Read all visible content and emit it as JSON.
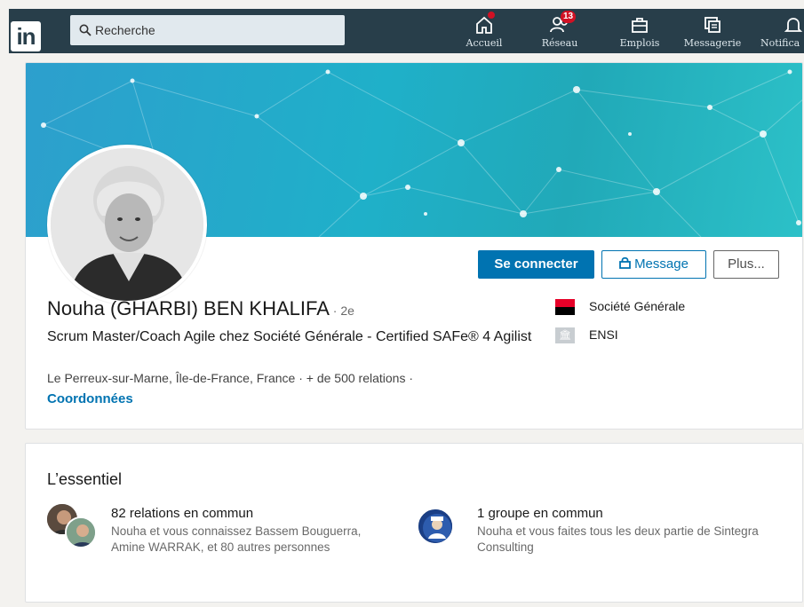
{
  "nav": {
    "logo": "in",
    "search_placeholder": "Recherche",
    "items": [
      {
        "label": "Accueil",
        "icon": "home-icon",
        "badge": "dot"
      },
      {
        "label": "Réseau",
        "icon": "network-icon",
        "badge": "13"
      },
      {
        "label": "Emplois",
        "icon": "briefcase-icon"
      },
      {
        "label": "Messagerie",
        "icon": "messaging-icon"
      },
      {
        "label": "Notifica",
        "icon": "bell-icon"
      }
    ]
  },
  "profile": {
    "name": "Nouha (GHARBI) BEN KHALIFA",
    "degree": " · 2e",
    "headline": "Scrum Master/Coach Agile chez Société Générale - Certified SAFe® 4 Agilist",
    "location": "Le Perreux-sur-Marne, Île-de-France, France  ·  + de 500 relations  ·",
    "contact": "Coordonnées",
    "buttons": {
      "connect": "Se connecter",
      "message": "Message",
      "more": "Plus..."
    },
    "organizations": [
      {
        "name": "Société Générale",
        "icon": "societe-generale-logo"
      },
      {
        "name": "ENSI",
        "icon": "school-icon"
      }
    ]
  },
  "essentials": {
    "title": "L’essentiel",
    "connections": {
      "title": "82 relations en commun",
      "description": "Nouha et vous connaissez Bassem Bouguerra, Amine WARRAK, et 80 autres personnes"
    },
    "groups": {
      "title": "1 groupe en commun",
      "description": "Nouha et vous faites tous les deux partie de Sintegra Consulting"
    }
  },
  "colors": {
    "nav_bg": "#283e4a",
    "primary": "#0073b1",
    "badge": "#d11124"
  }
}
